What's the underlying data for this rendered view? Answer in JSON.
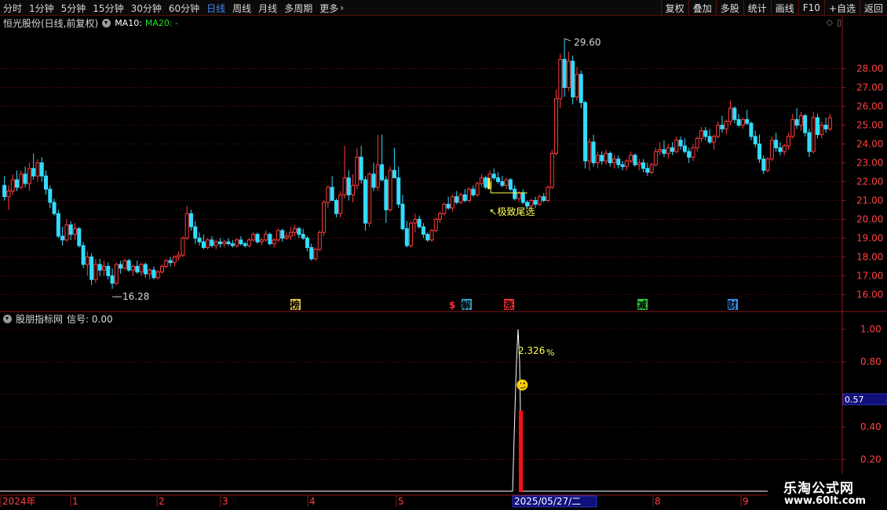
{
  "toolbar": {
    "period_tabs": [
      "分时",
      "1分钟",
      "5分钟",
      "15分钟",
      "30分钟",
      "60分钟",
      "日线",
      "周线",
      "月线",
      "多周期",
      "更多"
    ],
    "active_tab": "日线",
    "buttons": [
      "复权",
      "叠加",
      "多股",
      "统计",
      "画线",
      "F10",
      "+自选",
      "返回"
    ]
  },
  "main_chart": {
    "stock_title": "恒光股份(日线,前复权)",
    "ma10_label": "MA10:",
    "ma20_label": "MA20: -",
    "price_axis": [
      "28.00",
      "27.00",
      "26.00",
      "25.00",
      "24.00",
      "23.00",
      "22.00",
      "21.00",
      "20.00",
      "19.00",
      "18.00",
      "17.00",
      "16.00"
    ],
    "max_label": "29.60",
    "min_label": "16.28",
    "annotation": "↖极致尾选",
    "event_markers": [
      {
        "label": "榜",
        "color": "#e8c040",
        "text_color": "#000000"
      },
      {
        "label": "$",
        "color": "#ff3030",
        "text_color": "#ffffff"
      },
      {
        "label": "解",
        "color": "#3aa0c8",
        "text_color": "#000000"
      },
      {
        "label": "涨",
        "color": "#ff3030",
        "text_color": "#000000"
      },
      {
        "label": "减",
        "color": "#2ecc40",
        "text_color": "#000000"
      },
      {
        "label": "财",
        "color": "#3a8fe8",
        "text_color": "#000000"
      }
    ]
  },
  "indicator_panel": {
    "name": "股朋指标网",
    "signal_label": "信号: 0.00",
    "axis": [
      "1.00",
      "0.80",
      "0.40",
      "0.20"
    ],
    "current_value": "0.57",
    "pct_value": "2.326",
    "pct_sign": "%",
    "smiley": "☻"
  },
  "time_axis": {
    "labels": [
      "2024年",
      "1",
      "2",
      "3",
      "4",
      "5",
      "6",
      "7",
      "8",
      "9"
    ],
    "cursor_date": "2025/05/27/二"
  },
  "watermark": {
    "brand": "乐淘公式网",
    "url": "www.60lt.com"
  },
  "colors": {
    "up": "#ff3c3c",
    "down": "#32dcff",
    "active_tab": "#3d8bff",
    "grid": "#8a1a1a",
    "axis_text": "#ff4040",
    "annotation": "#ffff50",
    "signal_bar": "#ff1010"
  },
  "chart_data": {
    "type": "candlestick",
    "x_range": [
      "2024-12",
      "2025-09"
    ],
    "ylim": [
      15.6,
      29.9
    ],
    "ohlc": [
      [
        21.8,
        22.3,
        21.0,
        21.2
      ],
      [
        21.2,
        21.8,
        20.5,
        21.5
      ],
      [
        21.5,
        22.4,
        21.3,
        22.1
      ],
      [
        22.1,
        22.6,
        21.5,
        21.7
      ],
      [
        21.7,
        22.6,
        21.6,
        22.4
      ],
      [
        22.4,
        22.8,
        21.7,
        21.9
      ],
      [
        21.9,
        23.0,
        21.5,
        22.7
      ],
      [
        22.7,
        23.5,
        22.1,
        22.3
      ],
      [
        22.3,
        23.2,
        22.0,
        23.0
      ],
      [
        23.0,
        23.3,
        22.0,
        22.3
      ],
      [
        22.3,
        22.6,
        21.3,
        21.6
      ],
      [
        21.6,
        21.8,
        20.6,
        20.9
      ],
      [
        20.9,
        21.1,
        20.2,
        20.3
      ],
      [
        20.3,
        20.5,
        19.0,
        19.1
      ],
      [
        19.1,
        19.6,
        18.6,
        18.9
      ],
      [
        18.9,
        20.0,
        18.8,
        19.7
      ],
      [
        19.7,
        19.9,
        18.9,
        19.2
      ],
      [
        19.2,
        19.8,
        18.9,
        19.5
      ],
      [
        19.5,
        19.6,
        18.5,
        18.6
      ],
      [
        18.6,
        18.8,
        17.4,
        17.6
      ],
      [
        17.6,
        18.3,
        17.0,
        18.0
      ],
      [
        18.0,
        18.2,
        16.5,
        16.8
      ],
      [
        16.8,
        17.9,
        16.6,
        17.6
      ],
      [
        17.6,
        17.9,
        17.0,
        17.3
      ],
      [
        17.3,
        17.8,
        17.0,
        17.5
      ],
      [
        17.5,
        17.7,
        16.8,
        17.0
      ],
      [
        17.0,
        17.4,
        16.3,
        16.6
      ],
      [
        16.6,
        17.7,
        16.5,
        17.6
      ],
      [
        17.6,
        17.8,
        17.1,
        17.4
      ],
      [
        17.4,
        17.9,
        17.3,
        17.8
      ],
      [
        17.8,
        17.9,
        17.2,
        17.3
      ],
      [
        17.3,
        17.6,
        17.0,
        17.5
      ],
      [
        17.5,
        17.8,
        17.1,
        17.2
      ],
      [
        17.2,
        17.7,
        17.0,
        17.6
      ],
      [
        17.6,
        17.7,
        16.9,
        17.1
      ],
      [
        17.1,
        17.4,
        16.8,
        17.3
      ],
      [
        17.3,
        17.5,
        16.8,
        16.9
      ],
      [
        16.9,
        17.3,
        16.8,
        17.2
      ],
      [
        17.2,
        17.6,
        17.1,
        17.5
      ],
      [
        17.5,
        17.9,
        17.4,
        17.8
      ],
      [
        17.8,
        18.0,
        17.5,
        17.7
      ],
      [
        17.7,
        18.1,
        17.5,
        18.0
      ],
      [
        18.0,
        18.3,
        17.8,
        18.1
      ],
      [
        18.1,
        19.1,
        18.0,
        19.0
      ],
      [
        19.0,
        20.7,
        18.9,
        20.3
      ],
      [
        20.3,
        20.5,
        19.4,
        19.6
      ],
      [
        19.6,
        19.9,
        18.7,
        19.0
      ],
      [
        19.0,
        19.3,
        18.6,
        18.8
      ],
      [
        18.8,
        19.2,
        18.4,
        18.5
      ],
      [
        18.5,
        19.0,
        18.4,
        18.9
      ],
      [
        18.9,
        19.1,
        18.5,
        18.6
      ],
      [
        18.6,
        18.9,
        18.4,
        18.8
      ],
      [
        18.8,
        19.0,
        18.5,
        18.7
      ],
      [
        18.7,
        18.9,
        18.5,
        18.8
      ],
      [
        18.8,
        19.0,
        18.6,
        18.7
      ],
      [
        18.7,
        18.9,
        18.5,
        18.6
      ],
      [
        18.6,
        19.0,
        18.5,
        18.9
      ],
      [
        18.9,
        19.1,
        18.6,
        18.7
      ],
      [
        18.7,
        18.8,
        18.5,
        18.6
      ],
      [
        18.6,
        19.0,
        18.5,
        18.9
      ],
      [
        18.9,
        19.3,
        18.8,
        19.2
      ],
      [
        19.2,
        19.3,
        18.7,
        18.8
      ],
      [
        18.8,
        19.0,
        18.6,
        18.9
      ],
      [
        18.9,
        19.4,
        18.8,
        19.2
      ],
      [
        19.2,
        19.3,
        18.6,
        18.7
      ],
      [
        18.7,
        19.0,
        18.5,
        18.9
      ],
      [
        18.9,
        19.5,
        18.8,
        19.4
      ],
      [
        19.4,
        19.5,
        18.8,
        19.0
      ],
      [
        19.0,
        19.3,
        18.9,
        19.1
      ],
      [
        19.1,
        19.6,
        18.9,
        19.3
      ],
      [
        19.3,
        19.7,
        19.1,
        19.5
      ],
      [
        19.5,
        19.6,
        19.0,
        19.2
      ],
      [
        19.2,
        19.5,
        18.9,
        19.0
      ],
      [
        19.0,
        19.1,
        18.3,
        18.5
      ],
      [
        18.5,
        18.7,
        17.8,
        17.9
      ],
      [
        17.9,
        18.5,
        17.8,
        18.4
      ],
      [
        18.4,
        19.4,
        18.3,
        19.3
      ],
      [
        19.3,
        21.0,
        19.1,
        20.9
      ],
      [
        20.9,
        21.8,
        20.6,
        21.7
      ],
      [
        21.7,
        22.3,
        21.5,
        21.0
      ],
      [
        21.0,
        21.1,
        20.1,
        20.3
      ],
      [
        20.3,
        21.5,
        20.1,
        21.3
      ],
      [
        21.3,
        23.9,
        21.1,
        22.2
      ],
      [
        22.2,
        22.6,
        21.0,
        21.3
      ],
      [
        21.3,
        22.4,
        20.9,
        21.8
      ],
      [
        21.8,
        23.8,
        21.6,
        23.3
      ],
      [
        23.3,
        23.9,
        21.9,
        22.1
      ],
      [
        22.1,
        22.3,
        19.4,
        19.8
      ],
      [
        19.8,
        22.5,
        19.6,
        22.4
      ],
      [
        22.4,
        23.0,
        21.5,
        21.7
      ],
      [
        21.7,
        24.5,
        21.5,
        22.9
      ],
      [
        22.9,
        24.5,
        22.0,
        22.1
      ],
      [
        22.1,
        22.3,
        19.8,
        20.5
      ],
      [
        20.5,
        22.8,
        20.4,
        22.6
      ],
      [
        22.6,
        23.8,
        22.2,
        22.2
      ],
      [
        22.2,
        22.8,
        20.6,
        20.8
      ],
      [
        20.8,
        21.3,
        19.4,
        19.5
      ],
      [
        19.5,
        19.9,
        18.5,
        18.6
      ],
      [
        18.6,
        19.9,
        18.5,
        19.8
      ],
      [
        19.8,
        20.3,
        19.3,
        20.0
      ],
      [
        20.0,
        20.2,
        19.5,
        19.6
      ],
      [
        19.6,
        19.8,
        19.0,
        19.2
      ],
      [
        19.2,
        19.3,
        18.8,
        18.9
      ],
      [
        18.9,
        19.5,
        18.8,
        19.4
      ],
      [
        19.4,
        20.1,
        19.3,
        20.0
      ],
      [
        20.0,
        20.4,
        19.8,
        20.3
      ],
      [
        20.3,
        20.9,
        20.2,
        20.8
      ],
      [
        20.8,
        21.2,
        20.5,
        20.6
      ],
      [
        20.6,
        21.3,
        20.4,
        21.2
      ],
      [
        21.2,
        21.5,
        20.8,
        20.9
      ],
      [
        20.9,
        21.4,
        20.8,
        21.3
      ],
      [
        21.3,
        21.6,
        20.9,
        21.0
      ],
      [
        21.0,
        21.7,
        20.9,
        21.6
      ],
      [
        21.6,
        21.8,
        21.2,
        21.3
      ],
      [
        21.3,
        22.0,
        21.2,
        21.9
      ],
      [
        21.9,
        22.4,
        21.7,
        22.2
      ],
      [
        22.2,
        22.3,
        21.6,
        21.7
      ],
      [
        21.7,
        22.6,
        21.6,
        22.4
      ],
      [
        22.4,
        22.7,
        22.1,
        22.2
      ],
      [
        22.2,
        22.5,
        21.9,
        22.0
      ],
      [
        22.0,
        22.3,
        21.7,
        21.8
      ],
      [
        21.8,
        22.2,
        21.6,
        22.1
      ],
      [
        22.1,
        22.2,
        21.5,
        21.6
      ],
      [
        21.6,
        21.8,
        21.0,
        21.1
      ],
      [
        21.1,
        21.5,
        20.9,
        21.4
      ],
      [
        21.4,
        21.6,
        20.8,
        20.9
      ],
      [
        20.9,
        21.0,
        20.6,
        20.7
      ],
      [
        20.7,
        21.1,
        20.6,
        21.0
      ],
      [
        21.0,
        21.2,
        20.6,
        20.8
      ],
      [
        20.8,
        21.3,
        20.7,
        21.2
      ],
      [
        21.2,
        21.4,
        20.9,
        21.0
      ],
      [
        21.0,
        21.8,
        20.9,
        21.7
      ],
      [
        21.7,
        23.7,
        21.6,
        23.5
      ],
      [
        23.5,
        26.9,
        23.4,
        26.4
      ],
      [
        26.4,
        28.8,
        25.9,
        28.5
      ],
      [
        28.5,
        29.6,
        26.5,
        27.0
      ],
      [
        27.0,
        28.9,
        26.8,
        28.4
      ],
      [
        28.4,
        28.7,
        26.1,
        26.5
      ],
      [
        26.5,
        28.1,
        26.3,
        27.7
      ],
      [
        27.7,
        27.9,
        25.9,
        26.2
      ],
      [
        26.2,
        26.3,
        22.7,
        23.1
      ],
      [
        23.1,
        24.3,
        22.6,
        24.1
      ],
      [
        24.1,
        24.5,
        22.8,
        23.0
      ],
      [
        23.0,
        23.6,
        22.7,
        23.4
      ],
      [
        23.4,
        23.6,
        22.9,
        23.1
      ],
      [
        23.1,
        23.7,
        22.9,
        23.5
      ],
      [
        23.5,
        23.6,
        22.8,
        23.0
      ],
      [
        23.0,
        23.4,
        22.7,
        23.2
      ],
      [
        23.2,
        23.4,
        22.7,
        22.9
      ],
      [
        22.9,
        23.1,
        22.6,
        22.8
      ],
      [
        22.8,
        23.2,
        22.6,
        23.1
      ],
      [
        23.1,
        23.6,
        23.0,
        23.4
      ],
      [
        23.4,
        23.5,
        22.8,
        22.9
      ],
      [
        22.9,
        23.2,
        22.6,
        23.0
      ],
      [
        23.0,
        23.2,
        22.5,
        22.7
      ],
      [
        22.7,
        23.0,
        22.3,
        22.5
      ],
      [
        22.5,
        23.0,
        22.4,
        22.9
      ],
      [
        22.9,
        23.8,
        22.8,
        23.6
      ],
      [
        23.6,
        24.1,
        23.4,
        23.7
      ],
      [
        23.7,
        24.2,
        23.3,
        23.5
      ],
      [
        23.5,
        24.0,
        23.2,
        23.8
      ],
      [
        23.8,
        24.1,
        23.4,
        23.6
      ],
      [
        23.6,
        24.4,
        23.5,
        24.2
      ],
      [
        24.2,
        24.4,
        23.7,
        23.9
      ],
      [
        23.9,
        24.3,
        23.5,
        23.6
      ],
      [
        23.6,
        23.8,
        23.0,
        23.3
      ],
      [
        23.3,
        24.0,
        23.1,
        23.8
      ],
      [
        23.8,
        24.4,
        23.6,
        24.3
      ],
      [
        24.3,
        24.9,
        24.1,
        24.7
      ],
      [
        24.7,
        24.9,
        24.2,
        24.4
      ],
      [
        24.4,
        24.8,
        24.0,
        24.1
      ],
      [
        24.1,
        24.5,
        23.7,
        24.4
      ],
      [
        24.4,
        25.2,
        24.3,
        25.0
      ],
      [
        25.0,
        25.5,
        24.6,
        24.8
      ],
      [
        24.8,
        25.3,
        24.5,
        25.2
      ],
      [
        25.2,
        26.3,
        25.0,
        25.9
      ],
      [
        25.9,
        26.0,
        25.1,
        25.3
      ],
      [
        25.3,
        25.6,
        24.9,
        25.0
      ],
      [
        25.0,
        25.4,
        24.8,
        25.3
      ],
      [
        25.3,
        25.8,
        25.0,
        25.1
      ],
      [
        25.1,
        25.2,
        24.2,
        24.4
      ],
      [
        24.4,
        24.7,
        23.8,
        24.0
      ],
      [
        24.0,
        24.5,
        23.0,
        23.2
      ],
      [
        23.2,
        23.4,
        22.4,
        22.6
      ],
      [
        22.6,
        23.3,
        22.5,
        23.2
      ],
      [
        23.2,
        24.4,
        23.1,
        24.2
      ],
      [
        24.2,
        24.6,
        23.6,
        23.8
      ],
      [
        23.8,
        24.1,
        23.4,
        23.6
      ],
      [
        23.6,
        24.0,
        23.4,
        23.9
      ],
      [
        23.9,
        24.6,
        23.7,
        24.4
      ],
      [
        24.4,
        25.6,
        24.3,
        25.3
      ],
      [
        25.3,
        25.9,
        24.8,
        25.0
      ],
      [
        25.0,
        25.7,
        24.7,
        25.5
      ],
      [
        25.5,
        25.6,
        24.4,
        24.6
      ],
      [
        24.6,
        24.8,
        23.3,
        23.6
      ],
      [
        23.6,
        25.7,
        23.5,
        25.4
      ],
      [
        25.4,
        25.6,
        24.3,
        24.5
      ],
      [
        24.5,
        25.2,
        24.3,
        25.0
      ],
      [
        25.0,
        25.4,
        24.6,
        24.8
      ],
      [
        24.8,
        25.6,
        24.7,
        25.4
      ]
    ],
    "indicator": {
      "ylim": [
        0,
        1.1
      ],
      "ticks": [
        1.0,
        0.8,
        0.4,
        0.2
      ],
      "current_value": 0.57,
      "signal_bar_value": 0.5
    }
  }
}
